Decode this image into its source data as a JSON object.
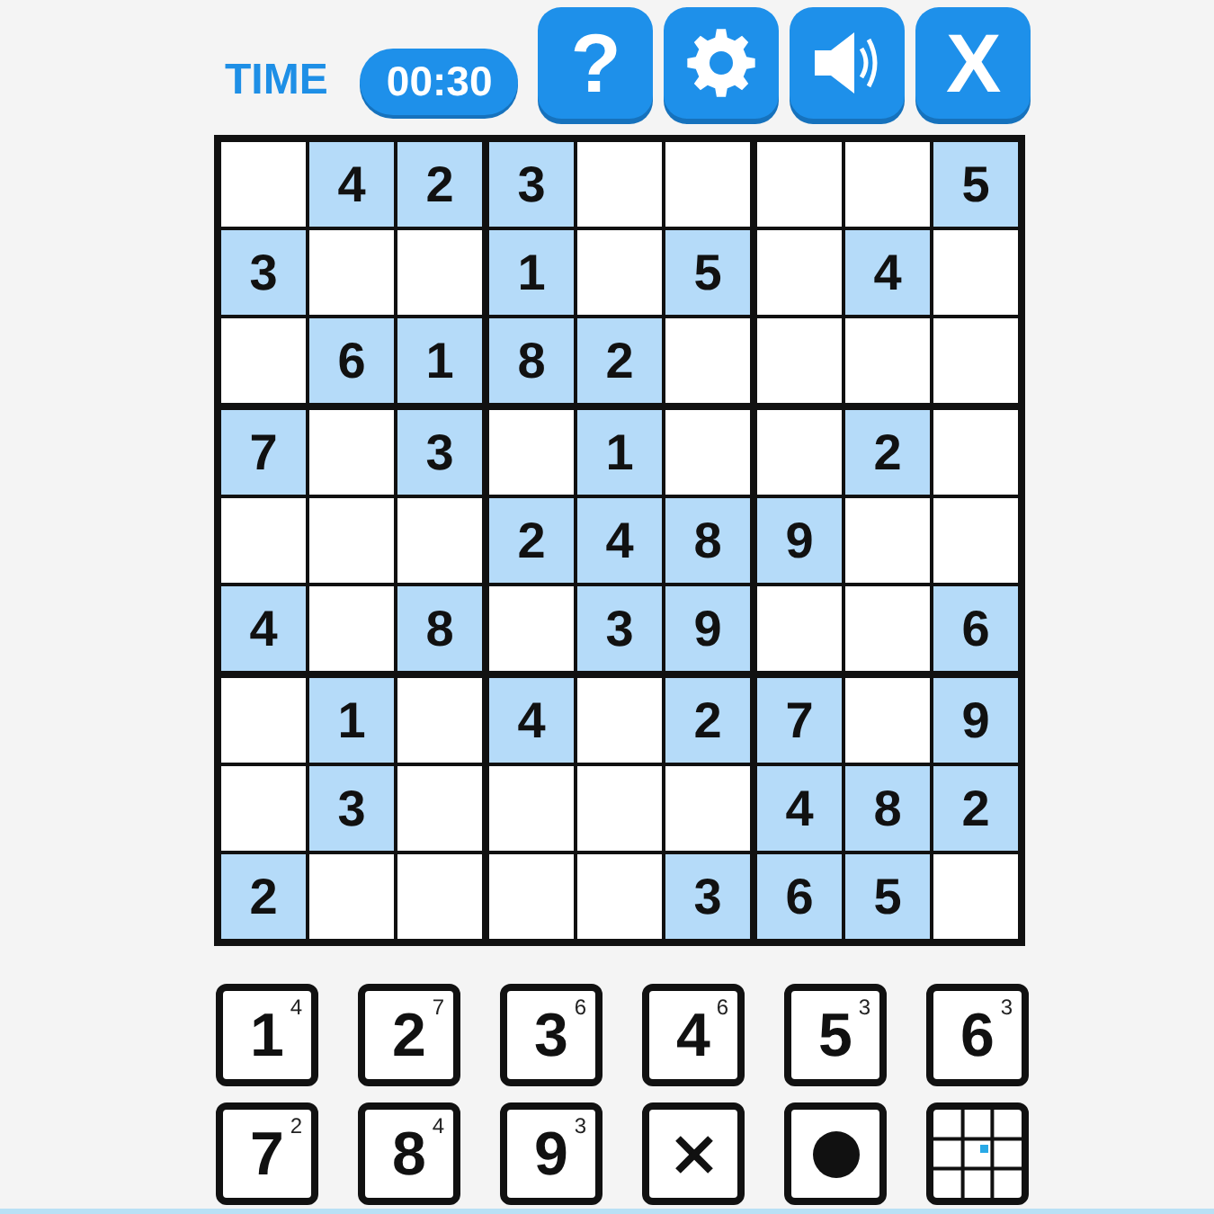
{
  "header": {
    "time_label": "TIME",
    "timer": "00:30",
    "buttons": [
      {
        "kind": "help",
        "label": "?"
      },
      {
        "kind": "settings"
      },
      {
        "kind": "sound"
      },
      {
        "kind": "close",
        "label": "X"
      }
    ]
  },
  "board": {
    "rows": [
      {
        "cells": [
          {
            "given": false
          },
          {
            "value": "4",
            "given": true
          },
          {
            "value": "2",
            "given": true
          },
          {
            "value": "3",
            "given": true
          },
          {
            "given": false
          },
          {
            "given": false
          },
          {
            "given": false
          },
          {
            "given": false
          },
          {
            "value": "5",
            "given": true
          }
        ]
      },
      {
        "cells": [
          {
            "value": "3",
            "given": true
          },
          {
            "given": false
          },
          {
            "given": false
          },
          {
            "value": "1",
            "given": true
          },
          {
            "given": false
          },
          {
            "value": "5",
            "given": true
          },
          {
            "given": false
          },
          {
            "value": "4",
            "given": true
          },
          {
            "given": false
          }
        ]
      },
      {
        "cells": [
          {
            "given": false
          },
          {
            "value": "6",
            "given": true
          },
          {
            "value": "1",
            "given": true
          },
          {
            "value": "8",
            "given": true
          },
          {
            "value": "2",
            "given": true
          },
          {
            "given": false
          },
          {
            "given": false
          },
          {
            "given": false
          },
          {
            "given": false
          }
        ]
      },
      {
        "cells": [
          {
            "value": "7",
            "given": true
          },
          {
            "given": false
          },
          {
            "value": "3",
            "given": true
          },
          {
            "given": false
          },
          {
            "value": "1",
            "given": true
          },
          {
            "given": false
          },
          {
            "given": false
          },
          {
            "value": "2",
            "given": true
          },
          {
            "given": false
          }
        ]
      },
      {
        "cells": [
          {
            "given": false
          },
          {
            "given": false
          },
          {
            "given": false
          },
          {
            "value": "2",
            "given": true
          },
          {
            "value": "4",
            "given": true
          },
          {
            "value": "8",
            "given": true
          },
          {
            "value": "9",
            "given": true
          },
          {
            "given": false
          },
          {
            "given": false
          }
        ]
      },
      {
        "cells": [
          {
            "value": "4",
            "given": true
          },
          {
            "given": false
          },
          {
            "value": "8",
            "given": true
          },
          {
            "given": false
          },
          {
            "value": "3",
            "given": true
          },
          {
            "value": "9",
            "given": true
          },
          {
            "given": false
          },
          {
            "given": false
          },
          {
            "value": "6",
            "given": true
          }
        ]
      },
      {
        "cells": [
          {
            "given": false
          },
          {
            "value": "1",
            "given": true
          },
          {
            "given": false
          },
          {
            "value": "4",
            "given": true
          },
          {
            "given": false
          },
          {
            "value": "2",
            "given": true
          },
          {
            "value": "7",
            "given": true
          },
          {
            "given": false
          },
          {
            "value": "9",
            "given": true
          }
        ]
      },
      {
        "cells": [
          {
            "given": false
          },
          {
            "value": "3",
            "given": true
          },
          {
            "given": false
          },
          {
            "given": false
          },
          {
            "given": false
          },
          {
            "given": false
          },
          {
            "value": "4",
            "given": true
          },
          {
            "value": "8",
            "given": true
          },
          {
            "value": "2",
            "given": true
          }
        ]
      },
      {
        "cells": [
          {
            "value": "2",
            "given": true
          },
          {
            "given": false
          },
          {
            "given": false
          },
          {
            "given": false
          },
          {
            "given": false
          },
          {
            "value": "3",
            "given": true
          },
          {
            "value": "6",
            "given": true
          },
          {
            "value": "5",
            "given": true
          },
          {
            "given": false
          }
        ]
      }
    ]
  },
  "pad": {
    "keys": [
      {
        "kind": "digit",
        "digit": "1",
        "count": "4"
      },
      {
        "kind": "digit",
        "digit": "2",
        "count": "7"
      },
      {
        "kind": "digit",
        "digit": "3",
        "count": "6"
      },
      {
        "kind": "digit",
        "digit": "4",
        "count": "6"
      },
      {
        "kind": "digit",
        "digit": "5",
        "count": "3"
      },
      {
        "kind": "digit",
        "digit": "6",
        "count": "3"
      },
      {
        "kind": "digit",
        "digit": "7",
        "count": "2"
      },
      {
        "kind": "digit",
        "digit": "8",
        "count": "4"
      },
      {
        "kind": "digit",
        "digit": "9",
        "count": "3"
      },
      {
        "kind": "erase"
      },
      {
        "kind": "dot"
      },
      {
        "kind": "grid"
      }
    ]
  }
}
